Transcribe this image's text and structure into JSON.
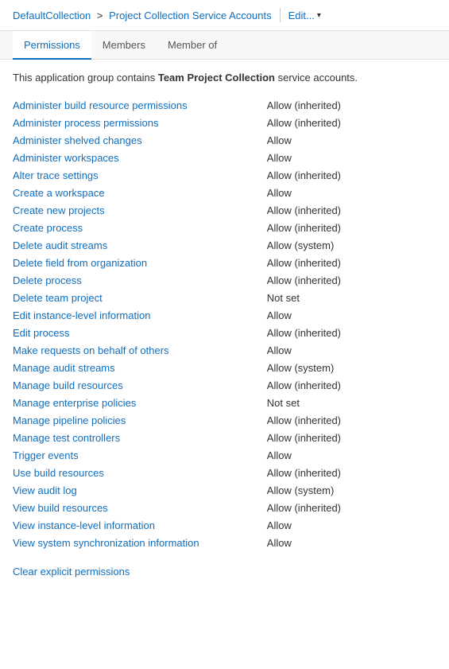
{
  "header": {
    "breadcrumb_link_label": "DefaultCollection",
    "separator": ">",
    "current_page": "Project Collection Service Accounts",
    "edit_label": "Edit...",
    "chevron": "▾"
  },
  "tabs": [
    {
      "id": "permissions",
      "label": "Permissions",
      "active": true
    },
    {
      "id": "members",
      "label": "Members",
      "active": false
    },
    {
      "id": "member-of",
      "label": "Member of",
      "active": false
    }
  ],
  "description": "This application group contains Team Project Collection service accounts.",
  "permissions": [
    {
      "name": "Administer build resource permissions",
      "status": "Allow (inherited)"
    },
    {
      "name": "Administer process permissions",
      "status": "Allow (inherited)"
    },
    {
      "name": "Administer shelved changes",
      "status": "Allow"
    },
    {
      "name": "Administer workspaces",
      "status": "Allow"
    },
    {
      "name": "Alter trace settings",
      "status": "Allow (inherited)"
    },
    {
      "name": "Create a workspace",
      "status": "Allow"
    },
    {
      "name": "Create new projects",
      "status": "Allow (inherited)"
    },
    {
      "name": "Create process",
      "status": "Allow (inherited)"
    },
    {
      "name": "Delete audit streams",
      "status": "Allow (system)"
    },
    {
      "name": "Delete field from organization",
      "status": "Allow (inherited)"
    },
    {
      "name": "Delete process",
      "status": "Allow (inherited)"
    },
    {
      "name": "Delete team project",
      "status": "Not set"
    },
    {
      "name": "Edit instance-level information",
      "status": "Allow"
    },
    {
      "name": "Edit process",
      "status": "Allow (inherited)"
    },
    {
      "name": "Make requests on behalf of others",
      "status": "Allow"
    },
    {
      "name": "Manage audit streams",
      "status": "Allow (system)"
    },
    {
      "name": "Manage build resources",
      "status": "Allow (inherited)"
    },
    {
      "name": "Manage enterprise policies",
      "status": "Not set"
    },
    {
      "name": "Manage pipeline policies",
      "status": "Allow (inherited)"
    },
    {
      "name": "Manage test controllers",
      "status": "Allow (inherited)"
    },
    {
      "name": "Trigger events",
      "status": "Allow"
    },
    {
      "name": "Use build resources",
      "status": "Allow (inherited)"
    },
    {
      "name": "View audit log",
      "status": "Allow (system)"
    },
    {
      "name": "View build resources",
      "status": "Allow (inherited)"
    },
    {
      "name": "View instance-level information",
      "status": "Allow"
    },
    {
      "name": "View system synchronization information",
      "status": "Allow"
    }
  ],
  "clear_link_label": "Clear explicit permissions"
}
